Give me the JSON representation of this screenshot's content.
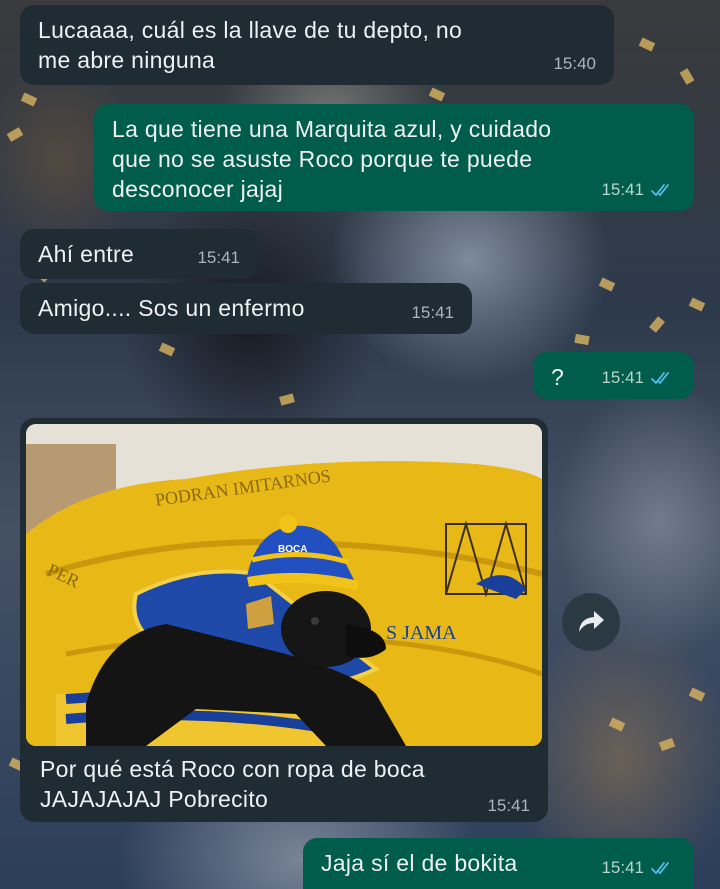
{
  "chat": {
    "messages": [
      {
        "direction": "in",
        "text": "Lucaaaa, cuál es la llave de tu depto, no\nme abre ninguna",
        "time": "15:40"
      },
      {
        "direction": "out",
        "text": "La que tiene una Marquita azul, y cuidado\nque no se asuste Roco porque te puede\ndesconocer jajaj",
        "time": "15:41",
        "status": "read"
      },
      {
        "direction": "in",
        "text": "Ahí entre",
        "time": "15:41"
      },
      {
        "direction": "in",
        "text": "Amigo.... Sos un enfermo",
        "time": "15:41"
      },
      {
        "direction": "out",
        "text": "?",
        "time": "15:41",
        "status": "read"
      },
      {
        "direction": "in",
        "type": "image",
        "caption": "Por qué está Roco con ropa de boca\nJAJAJAJAJ Pobrecito",
        "time": "15:41",
        "photo_text": {
          "flag_top": "PODRAN IMITARNOS",
          "flag_left": "PER",
          "flag_right": "S JAMA",
          "hat": "BOCA"
        }
      },
      {
        "direction": "out",
        "text": "Jaja sí el de bokita",
        "time": "15:41",
        "status": "read"
      }
    ]
  },
  "icons": {
    "forward": "share-forward-icon",
    "read_receipt": "double-check-icon"
  },
  "colors": {
    "incoming_bubble": "#1f2c34",
    "outgoing_bubble": "#005c4b",
    "read_ticks": "#53bdeb",
    "boca_blue": "#1a3f9a",
    "boca_yellow": "#f2c318"
  }
}
